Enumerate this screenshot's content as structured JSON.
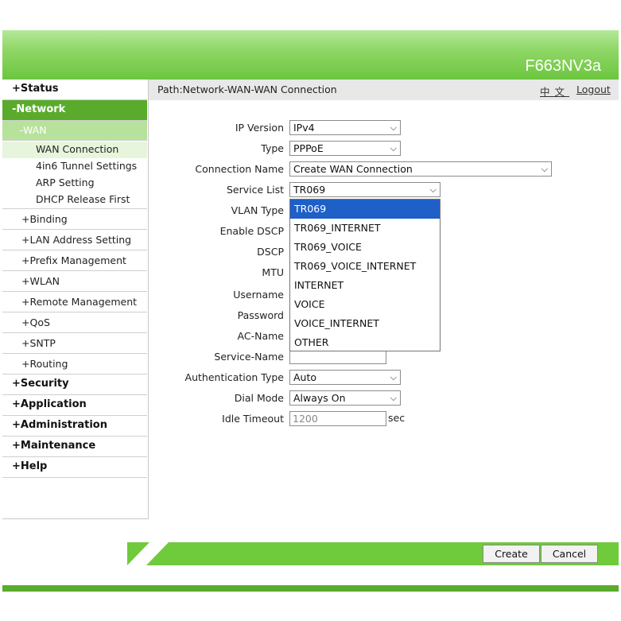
{
  "header": {
    "model": "F663NV3a"
  },
  "path": {
    "text": "Path:Network-WAN-WAN Connection",
    "lang": "中文",
    "logout": "Logout"
  },
  "sidebar": {
    "status": "+Status",
    "network": "-Network",
    "wan": "-WAN",
    "wan_items": [
      "WAN Connection",
      "4in6 Tunnel Settings",
      "ARP Setting",
      "DHCP Release First"
    ],
    "network_items": [
      "+Binding",
      "+LAN Address Setting",
      "+Prefix Management",
      "+WLAN",
      "+Remote Management",
      "+QoS",
      "+SNTP",
      "+Routing"
    ],
    "bottom_items": [
      "+Security",
      "+Application",
      "+Administration",
      "+Maintenance",
      "+Help"
    ]
  },
  "form": {
    "ip_version": {
      "label": "IP Version",
      "value": "IPv4"
    },
    "type": {
      "label": "Type",
      "value": "PPPoE"
    },
    "connection_name": {
      "label": "Connection Name",
      "value": "Create WAN Connection"
    },
    "service_list": {
      "label": "Service List",
      "value": "TR069"
    },
    "vlan_type": {
      "label": "VLAN Type"
    },
    "enable_dscp": {
      "label": "Enable DSCP"
    },
    "dscp": {
      "label": "DSCP"
    },
    "mtu": {
      "label": "MTU"
    },
    "username": {
      "label": "Username"
    },
    "password": {
      "label": "Password"
    },
    "ac_name": {
      "label": "AC-Name"
    },
    "service_name": {
      "label": "Service-Name",
      "value": ""
    },
    "auth_type": {
      "label": "Authentication Type",
      "value": "Auto"
    },
    "dial_mode": {
      "label": "Dial Mode",
      "value": "Always On"
    },
    "idle_timeout": {
      "label": "Idle Timeout",
      "value": "1200",
      "unit": "sec"
    }
  },
  "service_list_options": [
    "TR069",
    "TR069_INTERNET",
    "TR069_VOICE",
    "TR069_VOICE_INTERNET",
    "INTERNET",
    "VOICE",
    "VOICE_INTERNET",
    "OTHER"
  ],
  "buttons": {
    "create": "Create",
    "cancel": "Cancel"
  },
  "colors": {
    "brand_green": "#5aab2c",
    "highlight_blue": "#1e5fc8"
  }
}
